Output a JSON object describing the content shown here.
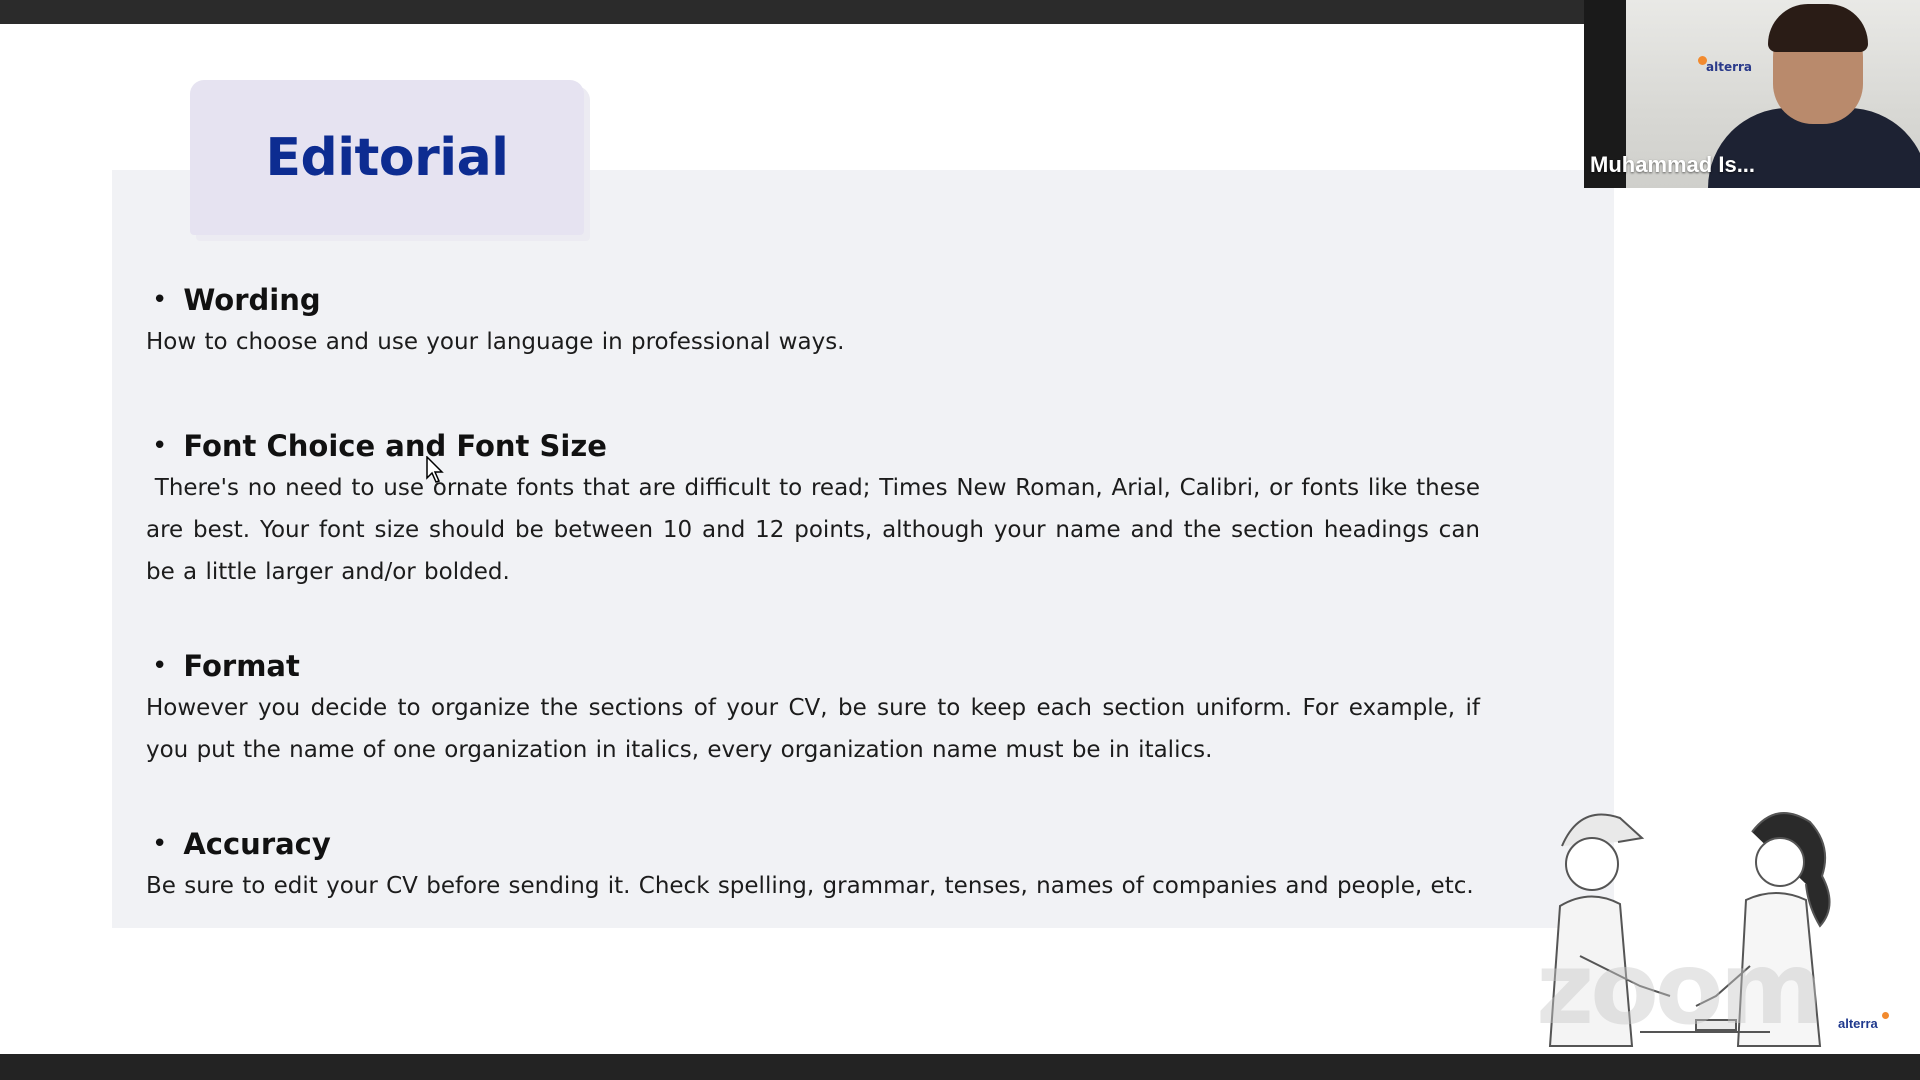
{
  "slide": {
    "title": "Editorial",
    "sections": [
      {
        "heading": "Wording",
        "body": "How to choose and use your language in professional ways."
      },
      {
        "heading": "Font Choice and Font Size",
        "body": " There's no need to use ornate fonts that are difficult to read; Times New Roman, Arial, Calibri, or fonts like these are best. Your font size should be between 10 and 12 points, although your name and the section headings can be a little larger and/or bolded."
      },
      {
        "heading": "Format",
        "body": "However you decide to organize the sections of your CV, be sure to keep each section uniform. For example, if you put the name of one organization in italics, every organization name must be in italics."
      },
      {
        "heading": "Accuracy",
        "body": "Be sure to edit your CV before sending it. Check spelling, grammar, tenses, names of companies and people, etc."
      }
    ],
    "bullet_glyph": "•",
    "brand_logo": "alterra",
    "watermark": "zoom"
  },
  "video": {
    "participant_name": "Muhammad Is...",
    "wall_logo": "alterra"
  },
  "colors": {
    "title_text": "#0d2c91",
    "title_box": "#e6e3f1",
    "content_panel": "#f1f2f5",
    "brand_accent": "#f28a2e"
  },
  "icons": {
    "cursor": "mouse-pointer-icon"
  }
}
